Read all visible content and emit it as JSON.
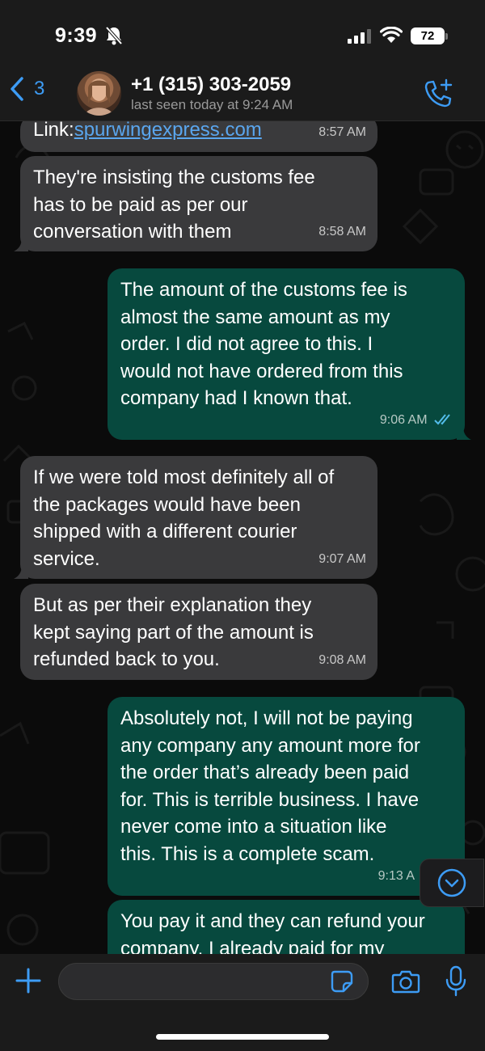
{
  "status_bar": {
    "time": "9:39",
    "battery": "72",
    "icons": [
      "bell-slash-icon",
      "signal-icon",
      "wifi-icon",
      "battery-icon"
    ]
  },
  "header": {
    "back_count": "3",
    "contact_name": "+1 (315) 303-2059",
    "last_seen": "last seen today at 9:24 AM",
    "icons": [
      "back-chevron-icon",
      "avatar",
      "add-call-icon"
    ]
  },
  "messages": [
    {
      "direction": "incoming",
      "prefix": "Link:",
      "link": "spurwingexpress.com",
      "time": "8:57 AM"
    },
    {
      "direction": "incoming",
      "text": "They're insisting the customs fee\nhas to be paid as per our\nconversation with them",
      "time": "8:58 AM"
    },
    {
      "direction": "outgoing",
      "text": "The amount of the customs fee is\nalmost the same amount as my\norder. I did not agree to this. I\nwould not have ordered from this\ncompany had I known that.",
      "time": "9:06 AM"
    },
    {
      "direction": "incoming",
      "text": "If we were told most definitely all of\nthe packages would have been\nshipped with a different courier\nservice.",
      "time": "9:07 AM"
    },
    {
      "direction": "incoming",
      "text": "But as per their explanation they\nkept saying part of the amount is\nrefunded back to you.",
      "time": "9:08 AM"
    },
    {
      "direction": "outgoing",
      "text": "Absolutely not, I will not be paying\nany company any amount more for\nthe order that’s already been paid\nfor. This is terrible business. I have\nnever come into a situation like\nthis. This is a complete scam.",
      "time": "9:13 A"
    },
    {
      "direction": "outgoing",
      "text": "You pay it and they can refund your\ncompany. I already paid for my",
      "time": ""
    }
  ],
  "colors": {
    "incoming_bubble": "#3a3a3c",
    "outgoing_bubble": "#07493e",
    "accent": "#3d9cf5",
    "link": "#5aa6ee",
    "read_ticks": "#53bdeb"
  },
  "input_bar": {
    "icons": [
      "plus-icon",
      "sticker-icon",
      "camera-icon",
      "microphone-icon"
    ]
  }
}
